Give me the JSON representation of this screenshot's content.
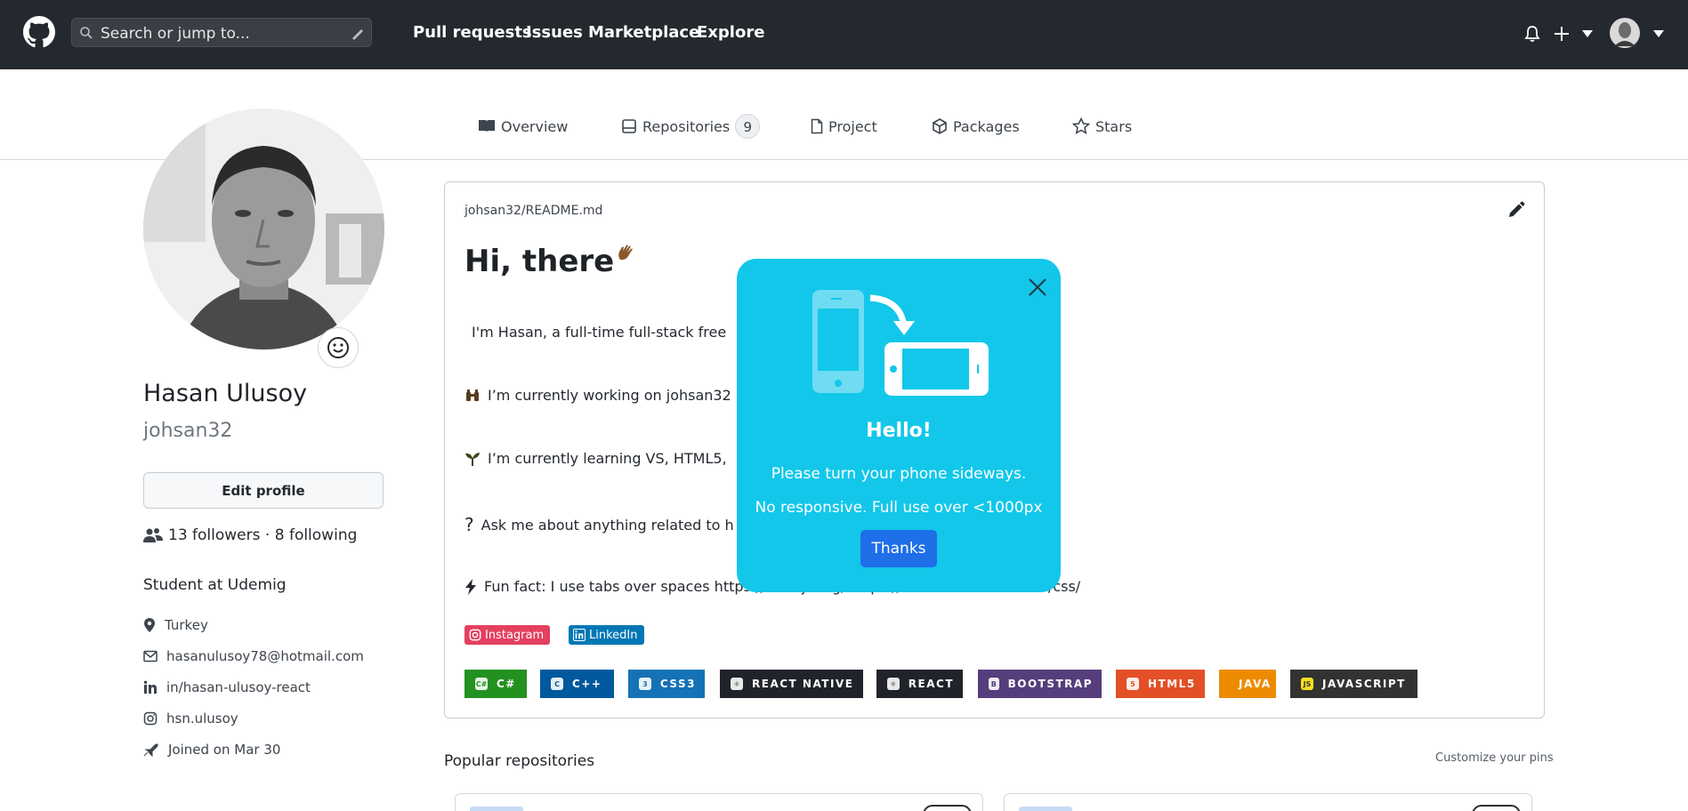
{
  "header": {
    "search_placeholder": "Search or jump to...",
    "nav": [
      "Pull requests",
      "Issues",
      "Marketplace",
      "Explore"
    ]
  },
  "tabs": [
    {
      "label": "Overview",
      "icon": "book-icon"
    },
    {
      "label": "Repositories",
      "icon": "repo-icon",
      "count": "9"
    },
    {
      "label": "Project",
      "icon": "file-icon"
    },
    {
      "label": "Packages",
      "icon": "package-icon"
    },
    {
      "label": "Stars",
      "icon": "star-icon"
    }
  ],
  "profile": {
    "name": "Hasan Ulusoy",
    "username": "johsan32",
    "edit_label": "Edit profile",
    "followers": "13",
    "followers_label": "followers",
    "separator": "·",
    "following": "8",
    "following_label": "following",
    "bio": "Student at Udemig",
    "location": "Turkey",
    "email": "hasanulusoy78@hotmail.com",
    "linkedin": "in/hasan-ulusoy-react",
    "instagram": "hsn.ulusoy",
    "joined": "Joined on Mar 30"
  },
  "readme": {
    "path": "johsan32/README.md",
    "greeting": "Hi, there",
    "lines": [
      "I'm Hasan, a full-time full-stack free",
      "I’m currently working on johsan32",
      "I’m currently learning VS, HTML5,",
      "Ask me about anything related to h",
      "Fun fact: I use tabs over spaces https://reactjs.org/ https://www.w3schools.com/css/"
    ],
    "question_mark": "?",
    "social": [
      "Instagram",
      "LinkedIn"
    ],
    "badges": [
      {
        "label": "C#",
        "color": "#239120",
        "icon_text": "C#"
      },
      {
        "label": "C++",
        "color": "#00599c",
        "icon_text": "C"
      },
      {
        "label": "CSS3",
        "color": "#1572b6",
        "icon_text": "3"
      },
      {
        "label": "REACT NATIVE",
        "color": "#20232a",
        "icon_text": "⚛"
      },
      {
        "label": "REACT",
        "color": "#20232a",
        "icon_text": "⚛"
      },
      {
        "label": "BOOTSTRAP",
        "color": "#563d7c",
        "icon_text": "B"
      },
      {
        "label": "HTML5",
        "color": "#e34f26",
        "icon_text": "5"
      },
      {
        "label": "JAVA",
        "color": "#ed8b00",
        "icon_text": ""
      },
      {
        "label": "JAVASCRIPT",
        "color": "#323330",
        "icon_text": "JS"
      }
    ]
  },
  "popular": {
    "title": "Popular repositories",
    "customize": "Customize your pins"
  },
  "popup": {
    "title": "Hello!",
    "message1": "Please turn your phone sideways.",
    "message2": "No responsive. Full use over <1000px",
    "button": "Thanks",
    "accent": "#12c7ea"
  },
  "colors": {
    "header_bg": "#24292f",
    "instagram": "#e4405f",
    "linkedin": "#0077b5"
  }
}
